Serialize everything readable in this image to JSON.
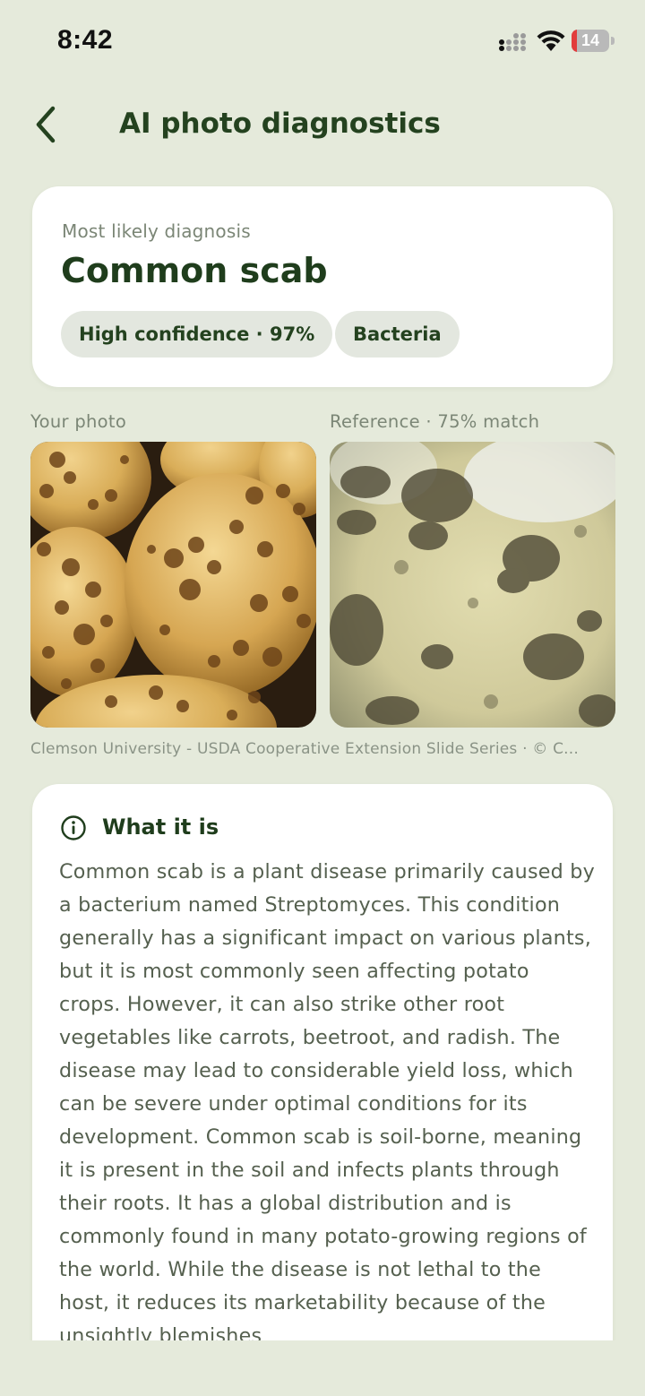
{
  "status_bar": {
    "time": "8:42",
    "battery_level": "14",
    "battery_fraction": 0.14,
    "battery_color": "#e23c3c",
    "icons": [
      "signal-icon",
      "wifi-icon",
      "battery-icon"
    ]
  },
  "header": {
    "back_icon": "chevron-left-icon",
    "title": "AI photo diagnostics"
  },
  "diagnosis": {
    "label": "Most likely diagnosis",
    "name": "Common scab",
    "confidence_chip": "High confidence · 97%",
    "type_chip": "Bacteria"
  },
  "photos": {
    "your_label": "Your photo",
    "reference_label": "Reference · 75% match",
    "credit": "Clemson University - USDA Cooperative Extension Slide Series · © C..."
  },
  "info": {
    "icon": "info-icon",
    "heading": "What it is",
    "body": "Common scab is a plant disease primarily caused by a bacterium named Streptomyces. This condition generally has a significant impact on various plants, but it is most commonly seen affecting potato crops. However, it can also strike other root vegetables like carrots, beetroot, and radish. The disease may lead to considerable yield loss, which can be severe under optimal conditions for its development. Common scab is soil-borne, meaning it is present in the soil and infects plants through their roots. It has a global distribution and is commonly found in many potato-growing regions of the world. While the disease is not lethal to the host, it reduces its marketability because of the unsightly blemishes"
  },
  "colors": {
    "background": "#e5eadb",
    "primary_text": "#1f3d1c",
    "chip_background": "#e3e7df",
    "card": "#ffffff"
  }
}
